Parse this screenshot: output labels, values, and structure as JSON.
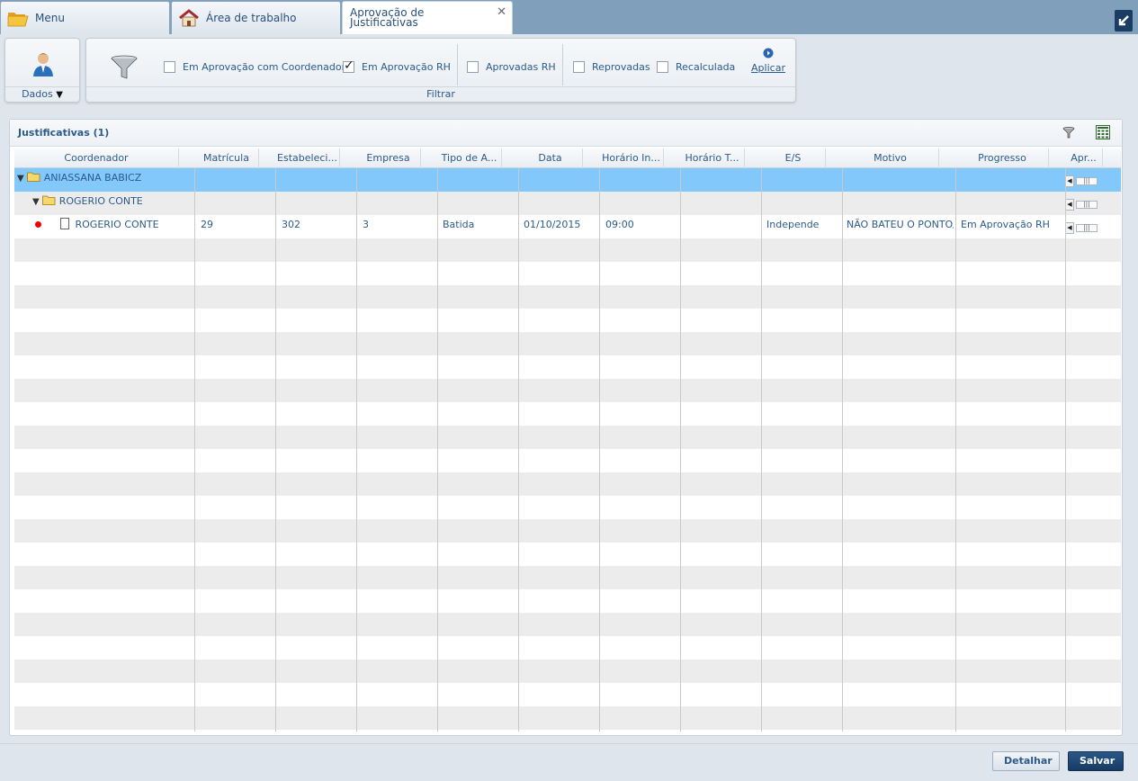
{
  "tabs": [
    {
      "label": "Menu",
      "icon": "folder-open-icon"
    },
    {
      "label": "Área de trabalho",
      "icon": "house-icon"
    },
    {
      "label_line1": "Aprovação de",
      "label_line2": "Justificativas",
      "active": true,
      "close": "✕"
    }
  ],
  "ribbon": {
    "dados_label": "Dados",
    "filter_group_label": "Filtrar",
    "checkboxes": [
      {
        "label": "Em Aprovação com Coordenador",
        "checked": false
      },
      {
        "label": "Em Aprovação RH",
        "checked": true
      },
      {
        "label": "Aprovadas RH",
        "checked": false
      },
      {
        "label": "Reprovadas",
        "checked": false
      },
      {
        "label": "Recalculada",
        "checked": false
      }
    ],
    "apply_label": "Aplicar"
  },
  "panel": {
    "title": "Justificativas (1)"
  },
  "grid": {
    "columns": [
      "Coordenador",
      "Matrícula",
      "Estabeleci...",
      "Empresa",
      "Tipo de A...",
      "Data",
      "Horário In...",
      "Horário T...",
      "E/S",
      "Motivo",
      "Progresso",
      "Apr..."
    ],
    "group1": "ANIASSANA BABICZ",
    "group2": "ROGERIO CONTE",
    "row": {
      "coordenador": "ROGERIO CONTE",
      "matricula": "29",
      "estabelecimento": "302",
      "empresa": "3",
      "tipo": "Batida",
      "data": "01/10/2015",
      "horario_inicio": "09:00",
      "horario_termino": "",
      "es": "Independe",
      "motivo": "NÃO BATEU O PONTO/E",
      "progresso": "Em Aprovação RH"
    }
  },
  "footer": {
    "detalhar": "Detalhar",
    "salvar": "Salvar"
  },
  "colors": {
    "selected_row": "#82c8fa",
    "text_blue": "#2b5b8c",
    "dark_button": "#1b3c63"
  }
}
